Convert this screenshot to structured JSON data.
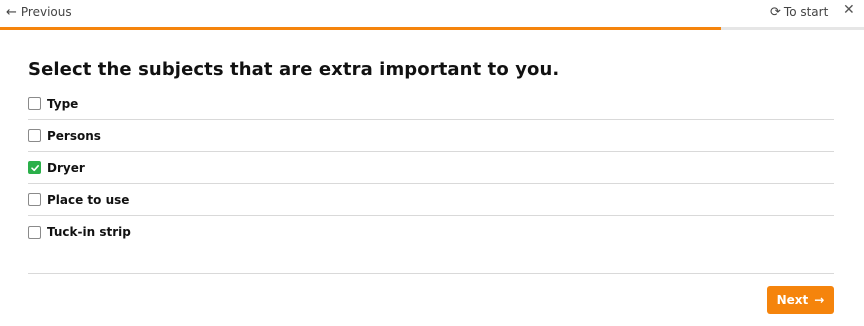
{
  "nav": {
    "previous_label": "Previous",
    "to_start_label": "To start",
    "icons": {
      "previous": "arrow-left-icon",
      "to_start": "refresh-icon",
      "close": "close-icon"
    }
  },
  "progress": {
    "fraction": 0.835,
    "color": "#f5840c"
  },
  "question": {
    "title": "Select the subjects that are extra important to you."
  },
  "options": [
    {
      "label": "Type",
      "checked": false
    },
    {
      "label": "Persons",
      "checked": false
    },
    {
      "label": "Dryer",
      "checked": true
    },
    {
      "label": "Place to use",
      "checked": false
    },
    {
      "label": "Tuck-in strip",
      "checked": false
    }
  ],
  "footer": {
    "next_label": "Next",
    "next_color": "#f5840c"
  },
  "colors": {
    "accent": "#f5840c",
    "checked": "#2bb04a"
  }
}
